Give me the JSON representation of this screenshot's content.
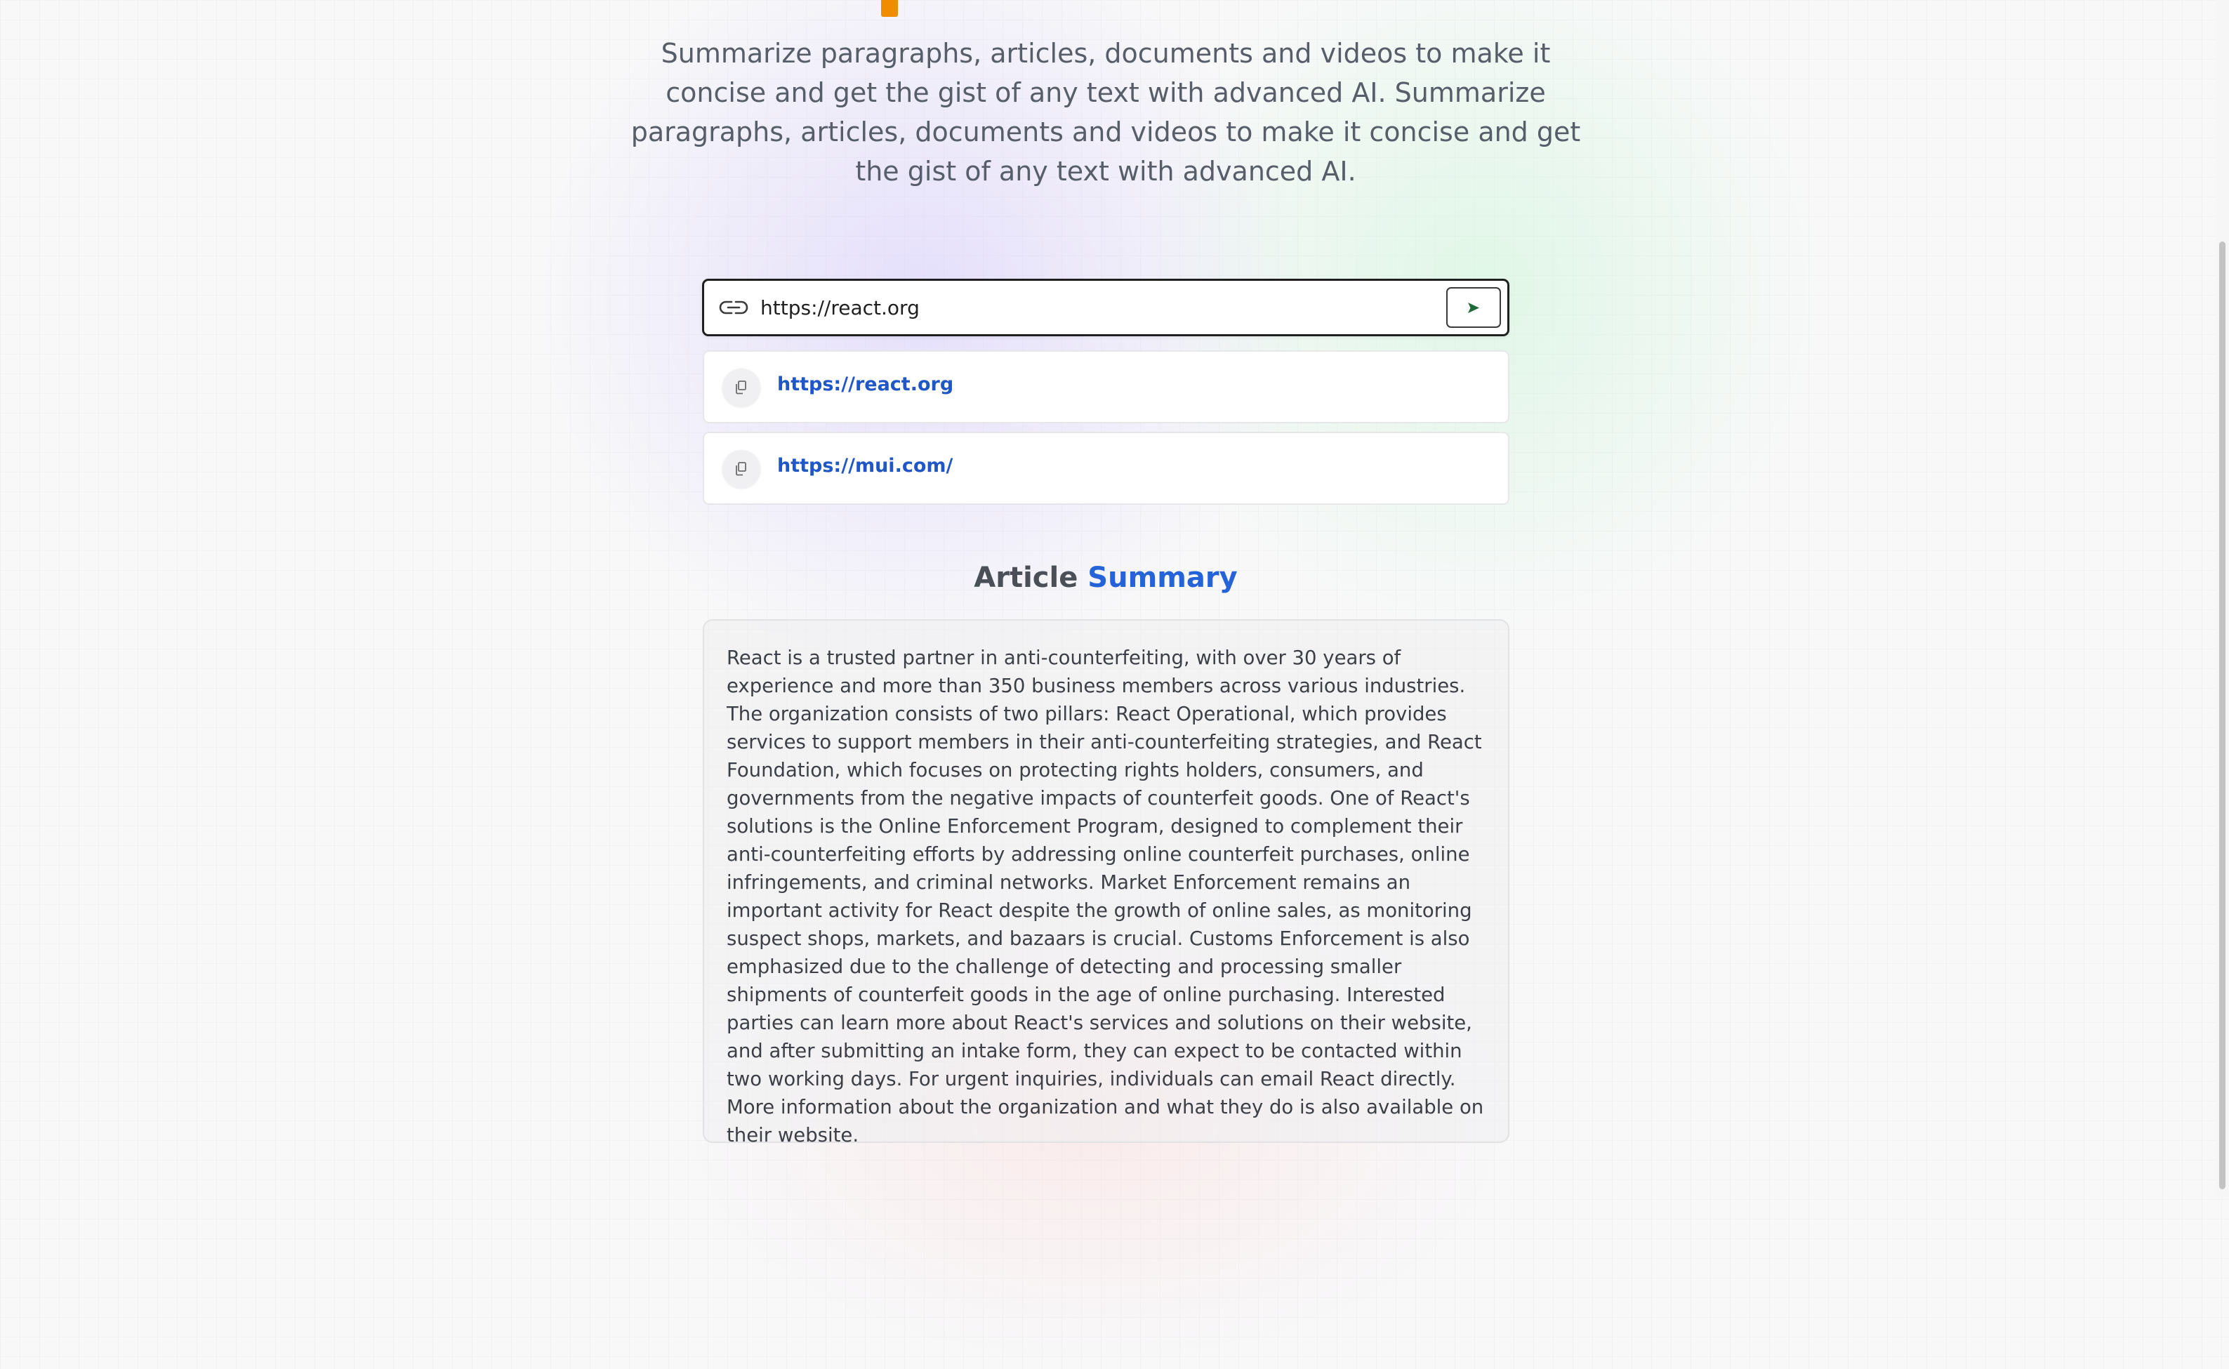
{
  "hero": {
    "subtitle": "Summarize paragraphs, articles, documents and videos to make it concise and get the gist of any text with advanced AI. Summarize paragraphs, articles, documents and videos to make it concise and get the gist of any text with advanced AI."
  },
  "url_form": {
    "value": "https://react.org",
    "icon": "link-icon",
    "submit_icon": "send-arrow-icon"
  },
  "history": {
    "items": [
      {
        "url": "https://react.org",
        "icon": "copy-icon"
      },
      {
        "url": "https://mui.com/",
        "icon": "copy-icon"
      }
    ]
  },
  "summary": {
    "heading_prefix": "Article",
    "heading_accent": "Summary",
    "text": "React is a trusted partner in anti-counterfeiting, with over 30 years of experience and more than 350 business members across various industries. The organization consists of two pillars: React Operational, which provides services to support members in their anti-counterfeiting strategies, and React Foundation, which focuses on protecting rights holders, consumers, and governments from the negative impacts of counterfeit goods. One of React's solutions is the Online Enforcement Program, designed to complement their anti-counterfeiting efforts by addressing online counterfeit purchases, online infringements, and criminal networks. Market Enforcement remains an important activity for React despite the growth of online sales, as monitoring suspect shops, markets, and bazaars is crucial. Customs Enforcement is also emphasized due to the challenge of detecting and processing smaller shipments of counterfeit goods in the age of online purchasing. Interested parties can learn more about React's services and solutions on their website, and after submitting an intake form, they can expect to be contacted within two working days. For urgent inquiries, individuals can email React directly. More information about the organization and what they do is also available on their website."
  },
  "colors": {
    "accent_orange": "#f08c00",
    "link_blue": "#1f57c7",
    "heading_blue": "#2563d9"
  }
}
